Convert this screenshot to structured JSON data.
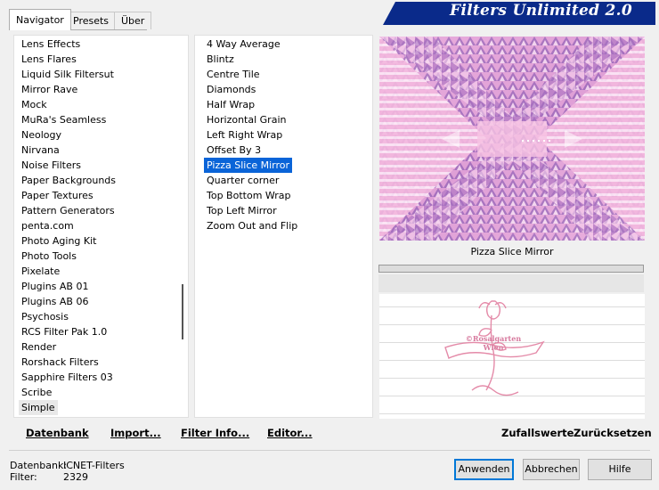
{
  "app": {
    "title": "Filters Unlimited 2.0"
  },
  "tabs": [
    {
      "label": "Navigator",
      "active": true
    },
    {
      "label": "Presets",
      "active": false
    },
    {
      "label": "Über",
      "active": false
    }
  ],
  "categories": [
    "Lens Effects",
    "Lens Flares",
    "Liquid Silk Filtersut",
    "Mirror Rave",
    "Mock",
    "MuRa's Seamless",
    "Neology",
    "Nirvana",
    "Noise Filters",
    "Paper Backgrounds",
    "Paper Textures",
    "Pattern Generators",
    "penta.com",
    "Photo Aging Kit",
    "Photo Tools",
    "Pixelate",
    "Plugins AB 01",
    "Plugins AB 06",
    "Psychosis",
    "RCS Filter Pak 1.0",
    "Render",
    "Rorshack Filters",
    "Sapphire Filters 03",
    "Scribe",
    "Simple"
  ],
  "categories_selected": "Simple",
  "filters": [
    "4 Way Average",
    "Blintz",
    "Centre Tile",
    "Diamonds",
    "Half Wrap",
    "Horizontal Grain",
    "Left Right Wrap",
    "Offset By 3",
    "Pizza Slice Mirror",
    "Quarter corner",
    "Top Bottom Wrap",
    "Top Left Mirror",
    "Zoom Out and Flip"
  ],
  "filters_selected": "Pizza Slice Mirror",
  "preview": {
    "label": "Pizza Slice Mirror"
  },
  "watermark": {
    "line1": "©Rosalgarten",
    "line2": "Wien"
  },
  "bottom_links": {
    "database": "Datenbank",
    "import": "Import...",
    "filter_info": "Filter Info...",
    "editor": "Editor...",
    "random": "Zufallswerte",
    "reset": "Zurücksetzen"
  },
  "status": {
    "database_label": "Datenbank:",
    "database_value": "ICNET-Filters",
    "filter_label": "Filter:",
    "filter_value": "2329"
  },
  "buttons": {
    "apply": "Anwenden",
    "cancel": "Abbrechen",
    "help": "Hilfe"
  },
  "colors": {
    "accent": "#0a64d8",
    "banner": "#0a2a8a",
    "preview_pink": "#e8a8d8",
    "preview_purple": "#8a5aa8"
  }
}
